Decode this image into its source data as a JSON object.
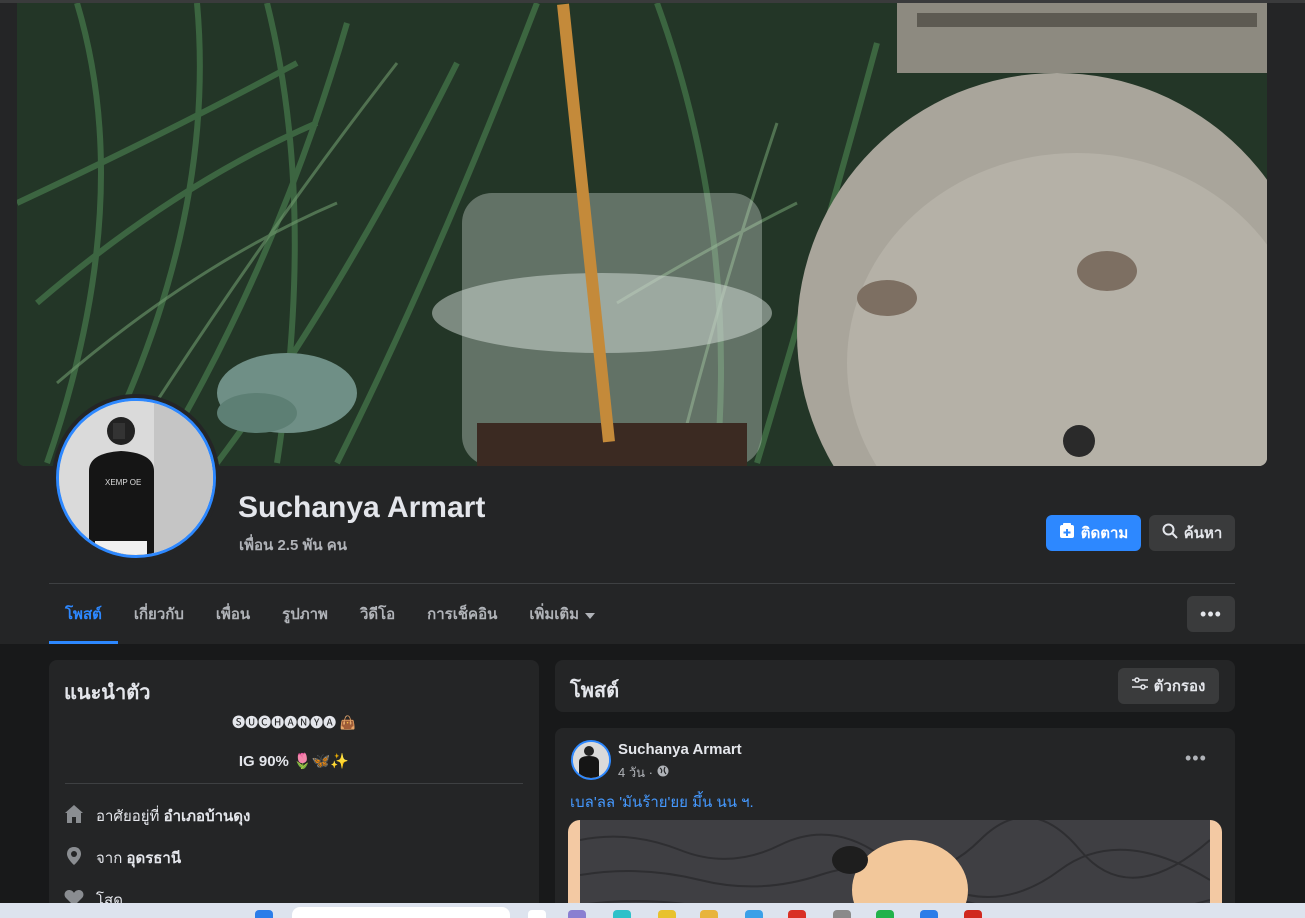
{
  "profile": {
    "name": "Suchanya Armart",
    "friends": "เพื่อน 2.5 พัน คน"
  },
  "actions": {
    "follow_label": "ติดตาม",
    "search_label": "ค้นหา",
    "more_label": "•••"
  },
  "tabs": [
    {
      "label": "โพสต์",
      "active": true
    },
    {
      "label": "เกี่ยวกับ",
      "active": false
    },
    {
      "label": "เพื่อน",
      "active": false
    },
    {
      "label": "รูปภาพ",
      "active": false
    },
    {
      "label": "วิดีโอ",
      "active": false
    },
    {
      "label": "การเช็คอิน",
      "active": false
    },
    {
      "label": "เพิ่มเติม",
      "active": false
    }
  ],
  "intro": {
    "title": "แนะนำตัว",
    "bio_line1": "🅢🅤🅒🅗🅐🅝🅨🅐",
    "bio_line1_emoji": "👜",
    "bio_line2": "IG 90%",
    "bio_line2_emoji": "🌷🦋✨",
    "lives_prefix": "อาศัยอยู่ที่",
    "lives_value": "อำเภอบ้านดุง",
    "from_prefix": "จาก",
    "from_value": "อุดรธานี",
    "relationship": "โสด"
  },
  "posts": {
    "title": "โพสต์",
    "filter_label": "ตัวกรอง",
    "items": [
      {
        "author": "Suchanya Armart",
        "time": "4 วัน ·",
        "text": "เบล'ลล 'มันร้าย'ยย มึ้น นน ฯ."
      }
    ]
  },
  "colors": {
    "accent": "#2d88ff",
    "background": "#18191a",
    "card": "#242526",
    "button_secondary": "#3a3b3c"
  }
}
